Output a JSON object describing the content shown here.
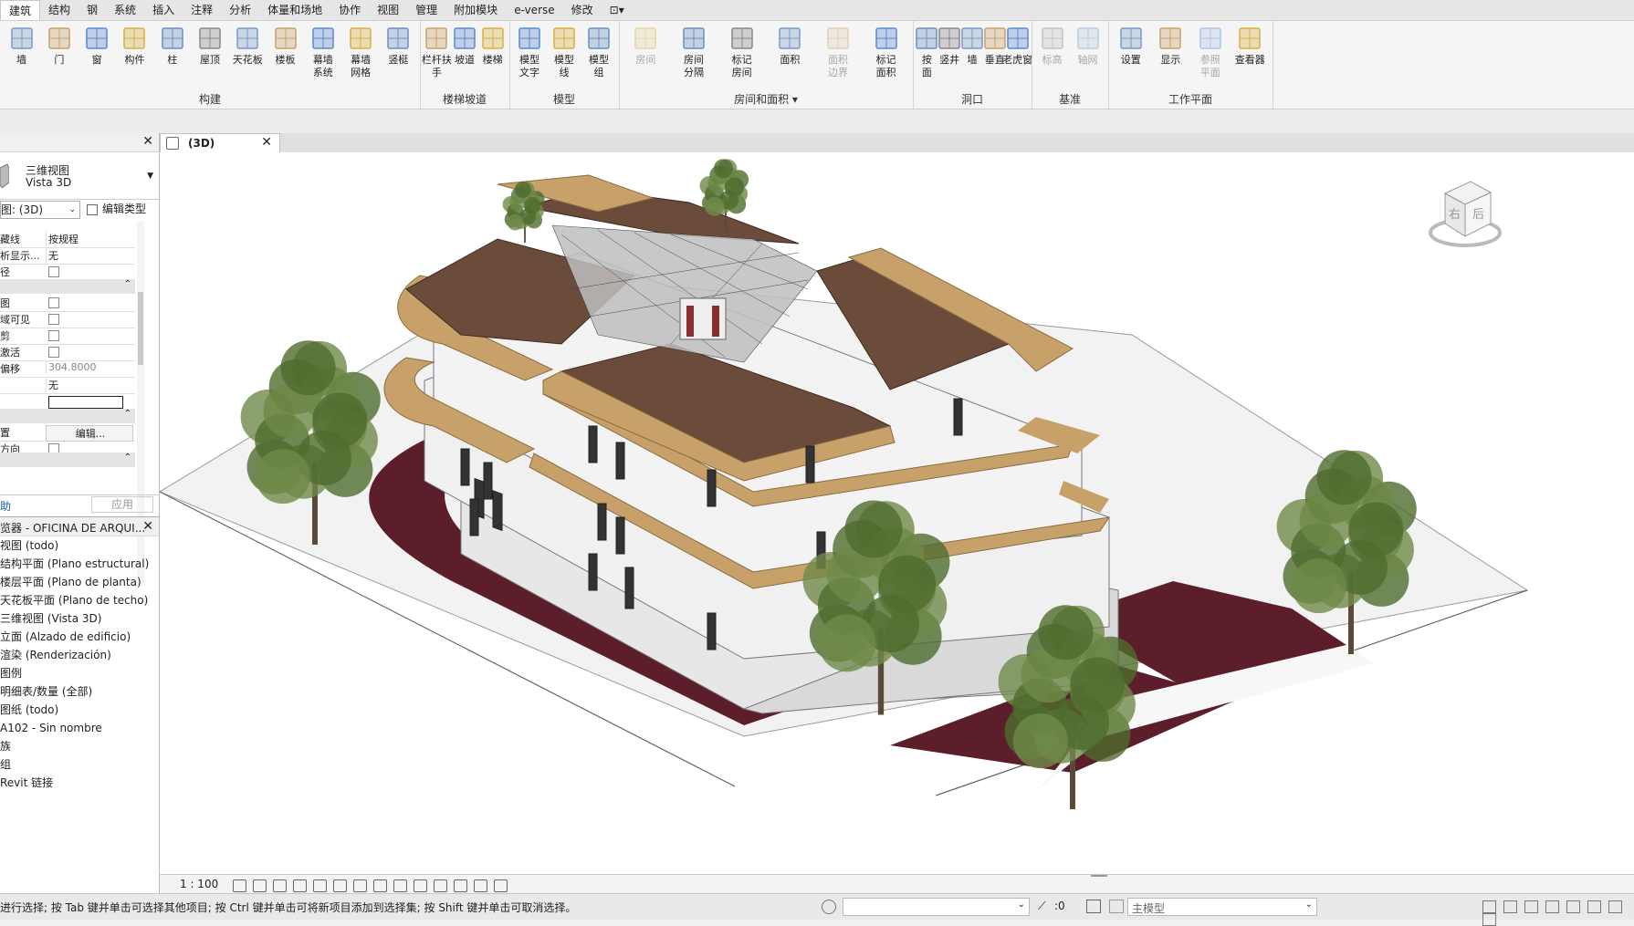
{
  "menu_tabs": [
    "建筑",
    "结构",
    "钢",
    "系统",
    "插入",
    "注释",
    "分析",
    "体量和场地",
    "协作",
    "视图",
    "管理",
    "附加模块",
    "e-verse",
    "修改",
    "⊡▾"
  ],
  "ribbon": {
    "groups": [
      {
        "label": "构建",
        "tools": [
          "墙",
          "门",
          "窗",
          "构件",
          "柱",
          "屋顶",
          "天花板",
          "楼板",
          "幕墙\n系统",
          "幕墙\n网格",
          "竖梃"
        ]
      },
      {
        "label": "楼梯坡道",
        "tools": [
          "栏杆扶手",
          "坡道",
          "楼梯"
        ]
      },
      {
        "label": "模型",
        "tools": [
          "模型\n文字",
          "模型\n线",
          "模型\n组"
        ]
      },
      {
        "label": "房间和面积 ▾",
        "tools": [
          "房间",
          "房间\n分隔",
          "标记\n房间",
          "面积",
          "面积\n边界",
          "标记\n面积"
        ]
      },
      {
        "label": "洞口",
        "tools": [
          "按\n面",
          "竖井",
          "墙",
          "垂直",
          "老虎窗"
        ]
      },
      {
        "label": "基准",
        "tools": [
          "标高",
          "轴网"
        ]
      },
      {
        "label": "工作平面",
        "tools": [
          "设置",
          "显示",
          "参照\n平面",
          "查看器"
        ]
      }
    ]
  },
  "properties": {
    "type_line1": "三维视图",
    "type_line2": "Vista 3D",
    "view_selector": "图: (3D)",
    "edit_type": "编辑类型",
    "rows": [
      {
        "k": "藏线",
        "v": "按规程"
      },
      {
        "k": "析显示...",
        "v": "无"
      },
      {
        "k": "径",
        "v": ""
      },
      {
        "k": "图",
        "v": ""
      },
      {
        "k": "域可见",
        "v": ""
      },
      {
        "k": "剪",
        "v": ""
      },
      {
        "k": "激活",
        "v": ""
      },
      {
        "k": "偏移",
        "v": "304.8000"
      },
      {
        "k": "",
        "v": "无"
      },
      {
        "k": "",
        "v": ""
      },
      {
        "k": "置",
        "v": "编辑..."
      },
      {
        "k": "方向",
        "v": ""
      }
    ],
    "help": "助",
    "apply": "应用"
  },
  "browser": {
    "title": "览器 - OFICINA DE ARQUI...",
    "items": [
      "视图 (todo)",
      "结构平面 (Plano estructural)",
      "楼层平面 (Plano de planta)",
      "天花板平面 (Plano de techo)",
      "三维视图 (Vista 3D)",
      "立面 (Alzado de edificio)",
      "渲染 (Renderización)",
      "图例",
      "明细表/数量 (全部)",
      "图纸 (todo)",
      "A102 - Sin nombre",
      "族",
      "组",
      "Revit 链接"
    ]
  },
  "view_tab": {
    "label": "(3D)"
  },
  "viewcube": {
    "face_front": "右",
    "face_right": "后"
  },
  "view_control": {
    "scale": "1 : 100"
  },
  "status": {
    "message": "进行选择; 按 Tab 键并单击可选择其他项目; 按 Ctrl 键并单击可将新项目添加到选择集; 按 Shift 键并单击可取消选择。",
    "count": ":0",
    "model": "主模型"
  },
  "colors": {
    "roof": "#6b4c3b",
    "eave": "#c8a16a",
    "wall": "#ededed",
    "path": "#5c1e2b",
    "tree": "#4f6b2e"
  }
}
